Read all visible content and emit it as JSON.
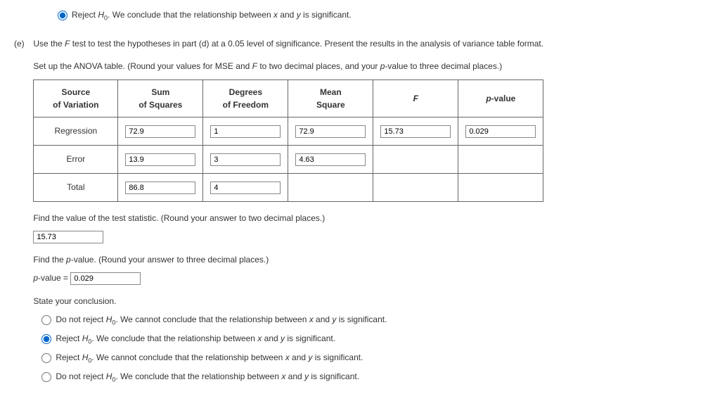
{
  "top_radio": {
    "prefix": "Reject ",
    "hyp": "H",
    "sub": "0",
    "suffix": ". We conclude that the relationship between ",
    "x": "x",
    "and": " and ",
    "y": "y",
    "end": " is significant."
  },
  "part_e": {
    "label": "(e)",
    "line1_a": "Use the ",
    "line1_F": "F",
    "line1_b": " test to test the hypotheses in part (d) at a 0.05 level of significance. Present the results in the analysis of variance table format.",
    "line2_a": "Set up the ANOVA table. (Round your values for MSE and ",
    "line2_F": "F",
    "line2_b": " to two decimal places, and your ",
    "line2_p": "p",
    "line2_c": "-value to three decimal places.)"
  },
  "anova": {
    "headers": {
      "source1": "Source",
      "source2": "of Variation",
      "sum1": "Sum",
      "sum2": "of Squares",
      "deg1": "Degrees",
      "deg2": "of Freedom",
      "mean1": "Mean",
      "mean2": "Square",
      "F": "F",
      "p": "p",
      "p_suffix": "-value"
    },
    "rows": {
      "regression": {
        "label": "Regression",
        "ss": "72.9",
        "df": "1",
        "ms": "72.9",
        "f": "15.73",
        "p": "0.029"
      },
      "error": {
        "label": "Error",
        "ss": "13.9",
        "df": "3",
        "ms": "4.63"
      },
      "total": {
        "label": "Total",
        "ss": "86.8",
        "df": "4"
      }
    }
  },
  "test_stat": {
    "prompt": "Find the value of the test statistic. (Round your answer to two decimal places.)",
    "value": "15.73"
  },
  "pvalue": {
    "prompt_a": "Find the ",
    "prompt_p": "p",
    "prompt_b": "-value. (Round your answer to three decimal places.)",
    "label_a": "p",
    "label_b": "-value = ",
    "value": "0.029"
  },
  "conclusion": {
    "heading": "State your conclusion.",
    "opt1": {
      "a": "Do not reject ",
      "h": "H",
      "s": "0",
      "b": ". We cannot conclude that the relationship between ",
      "x": "x",
      "and": " and ",
      "y": "y",
      "c": " is significant."
    },
    "opt2": {
      "a": "Reject ",
      "h": "H",
      "s": "0",
      "b": ". We conclude that the relationship between ",
      "x": "x",
      "and": " and ",
      "y": "y",
      "c": " is significant."
    },
    "opt3": {
      "a": "Reject ",
      "h": "H",
      "s": "0",
      "b": ". We cannot conclude that the relationship between ",
      "x": "x",
      "and": " and ",
      "y": "y",
      "c": " is significant."
    },
    "opt4": {
      "a": "Do not reject ",
      "h": "H",
      "s": "0",
      "b": ". We conclude that the relationship between ",
      "x": "x",
      "and": " and ",
      "y": "y",
      "c": " is significant."
    }
  }
}
